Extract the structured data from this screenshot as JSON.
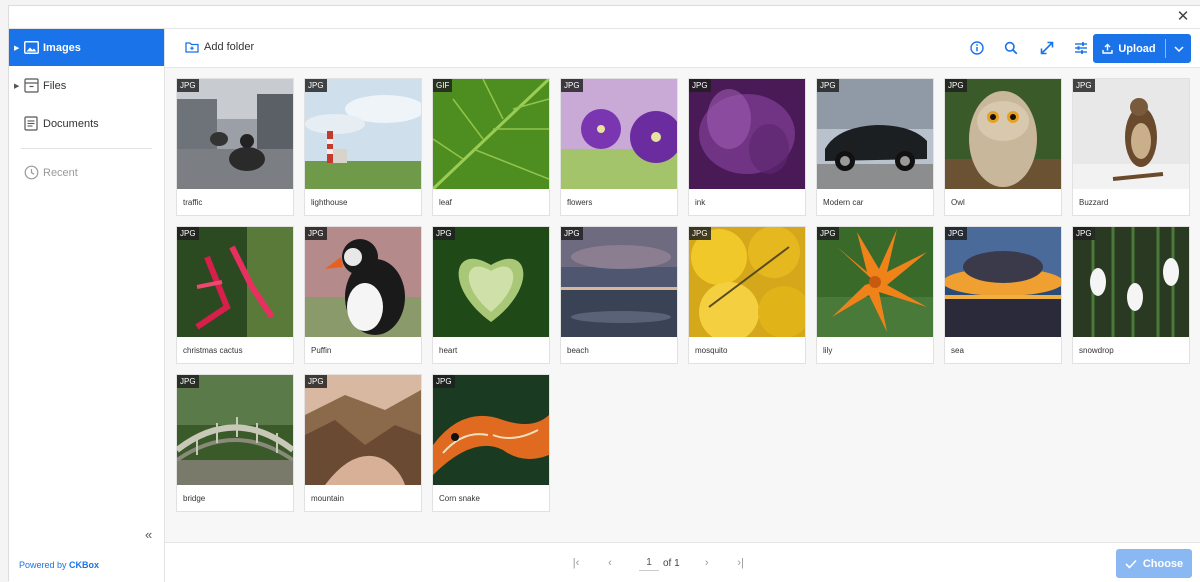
{
  "titlebar": {
    "close_glyph": "✕"
  },
  "sidebar": {
    "items": [
      {
        "label": "Images",
        "icon": "image-icon",
        "active": true
      },
      {
        "label": "Files",
        "icon": "archive-icon",
        "active": false
      },
      {
        "label": "Documents",
        "icon": "document-icon",
        "active": false
      },
      {
        "label": "Recent",
        "icon": "clock-icon",
        "active": false
      }
    ],
    "collapse_glyph": "«",
    "powered_prefix": "Powered by ",
    "powered_brand": "CKBox"
  },
  "toolbar": {
    "add_folder_label": "Add folder",
    "upload_label": "Upload",
    "icons": [
      "info-icon",
      "search-icon",
      "maximize-icon",
      "settings-sliders-icon"
    ]
  },
  "assets": [
    {
      "name": "traffic",
      "type": "JPG"
    },
    {
      "name": "lighthouse",
      "type": "JPG"
    },
    {
      "name": "leaf",
      "type": "GIF"
    },
    {
      "name": "flowers",
      "type": "JPG"
    },
    {
      "name": "ink",
      "type": "JPG"
    },
    {
      "name": "Modern car",
      "type": "JPG"
    },
    {
      "name": "Owl",
      "type": "JPG"
    },
    {
      "name": "Buzzard",
      "type": "JPG"
    },
    {
      "name": "christmas cactus",
      "type": "JPG"
    },
    {
      "name": "Puffin",
      "type": "JPG"
    },
    {
      "name": "heart",
      "type": "JPG"
    },
    {
      "name": "beach",
      "type": "JPG"
    },
    {
      "name": "mosquito",
      "type": "JPG"
    },
    {
      "name": "lily",
      "type": "JPG"
    },
    {
      "name": "sea",
      "type": "JPG"
    },
    {
      "name": "snowdrop",
      "type": "JPG"
    },
    {
      "name": "bridge",
      "type": "JPG"
    },
    {
      "name": "mountain",
      "type": "JPG"
    },
    {
      "name": "Corn snake",
      "type": "JPG"
    }
  ],
  "pagination": {
    "current_page": "1",
    "of_label": "of 1"
  },
  "footer": {
    "choose_label": "Choose"
  }
}
